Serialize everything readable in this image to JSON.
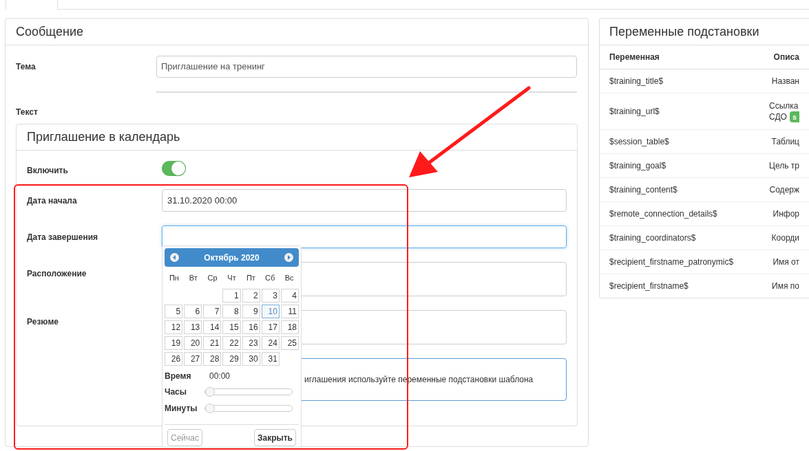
{
  "message": {
    "title": "Сообщение",
    "subject_label": "Тема",
    "subject_value": "Приглашение на тренинг",
    "text_label": "Текст",
    "invite": {
      "title": "Приглашение в календарь",
      "enable": {
        "label": "Включить",
        "on": true
      },
      "fields": [
        {
          "label": "Дата начала",
          "value": "31.10.2020 00:00",
          "focused": false,
          "kind": "input"
        },
        {
          "label": "Дата завершения",
          "focused": true,
          "kind": "input"
        },
        {
          "label": "Расположение",
          "focused": false,
          "kind": "tall"
        },
        {
          "label": "Резюме",
          "focused": false,
          "kind": "tall"
        }
      ],
      "info": "иглашения используйте переменные подстановки шаблона"
    }
  },
  "datepicker": {
    "month": "Октябрь 2020",
    "weekdays": [
      "Пн",
      "Вт",
      "Ср",
      "Чт",
      "Пт",
      "Сб",
      "Вс"
    ],
    "weeks": [
      [
        {
          "kind": "blank"
        },
        {
          "kind": "blank"
        },
        {
          "kind": "blank"
        },
        {
          "label": "1",
          "today": false
        },
        {
          "label": "2",
          "today": false
        },
        {
          "label": "3",
          "today": false
        },
        {
          "label": "4",
          "today": false
        }
      ],
      [
        {
          "label": "5",
          "today": false
        },
        {
          "label": "6",
          "today": false
        },
        {
          "label": "7",
          "today": false
        },
        {
          "label": "8",
          "today": false
        },
        {
          "label": "9",
          "today": false
        },
        {
          "label": "10",
          "today": true
        },
        {
          "label": "11",
          "today": false
        }
      ],
      [
        {
          "label": "12",
          "today": false
        },
        {
          "label": "13",
          "today": false
        },
        {
          "label": "14",
          "today": false
        },
        {
          "label": "15",
          "today": false
        },
        {
          "label": "16",
          "today": false
        },
        {
          "label": "17",
          "today": false
        },
        {
          "label": "18",
          "today": false
        }
      ],
      [
        {
          "label": "19",
          "today": false
        },
        {
          "label": "20",
          "today": false
        },
        {
          "label": "21",
          "today": false
        },
        {
          "label": "22",
          "today": false
        },
        {
          "label": "23",
          "today": false
        },
        {
          "label": "24",
          "today": false
        },
        {
          "label": "25",
          "today": false
        }
      ],
      [
        {
          "label": "26",
          "today": false
        },
        {
          "label": "27",
          "today": false
        },
        {
          "label": "28",
          "today": false
        },
        {
          "label": "29",
          "today": false
        },
        {
          "label": "30",
          "today": false
        },
        {
          "label": "31",
          "today": false
        },
        {
          "kind": "blank"
        }
      ]
    ],
    "time_label": "Время",
    "time_value": "00:00",
    "sliders": [
      {
        "label": "Часы",
        "level": 0
      },
      {
        "label": "Минуты",
        "level": 0
      }
    ],
    "buttons": [
      {
        "label": "Сейчас",
        "disabled": true
      },
      {
        "label": "Закрыть",
        "disabled": false
      }
    ]
  },
  "variables": {
    "title": "Переменные подстановки",
    "columns": [
      "Переменная",
      "Описа"
    ],
    "rows": [
      {
        "variable": "$training_title$",
        "description": [
          "Назван"
        ]
      },
      {
        "variable": "$training_url$",
        "description": [
          "Ссылка",
          "СДО"
        ],
        "badge": "s"
      },
      {
        "variable": "$session_table$",
        "description": [
          "Таблиц"
        ]
      },
      {
        "variable": "$training_goal$",
        "description": [
          "Цель тр"
        ]
      },
      {
        "variable": "$training_content$",
        "description": [
          "Содерж"
        ]
      },
      {
        "variable": "$remote_connection_details$",
        "description": [
          "Инфор"
        ]
      },
      {
        "variable": "$training_coordinators$",
        "description": [
          "Коорди"
        ]
      },
      {
        "variable": "$recipient_firstname_patronymic$",
        "description": [
          "Имя от"
        ]
      },
      {
        "variable": "$recipient_firstname$",
        "description": [
          "Имя по"
        ]
      }
    ]
  }
}
